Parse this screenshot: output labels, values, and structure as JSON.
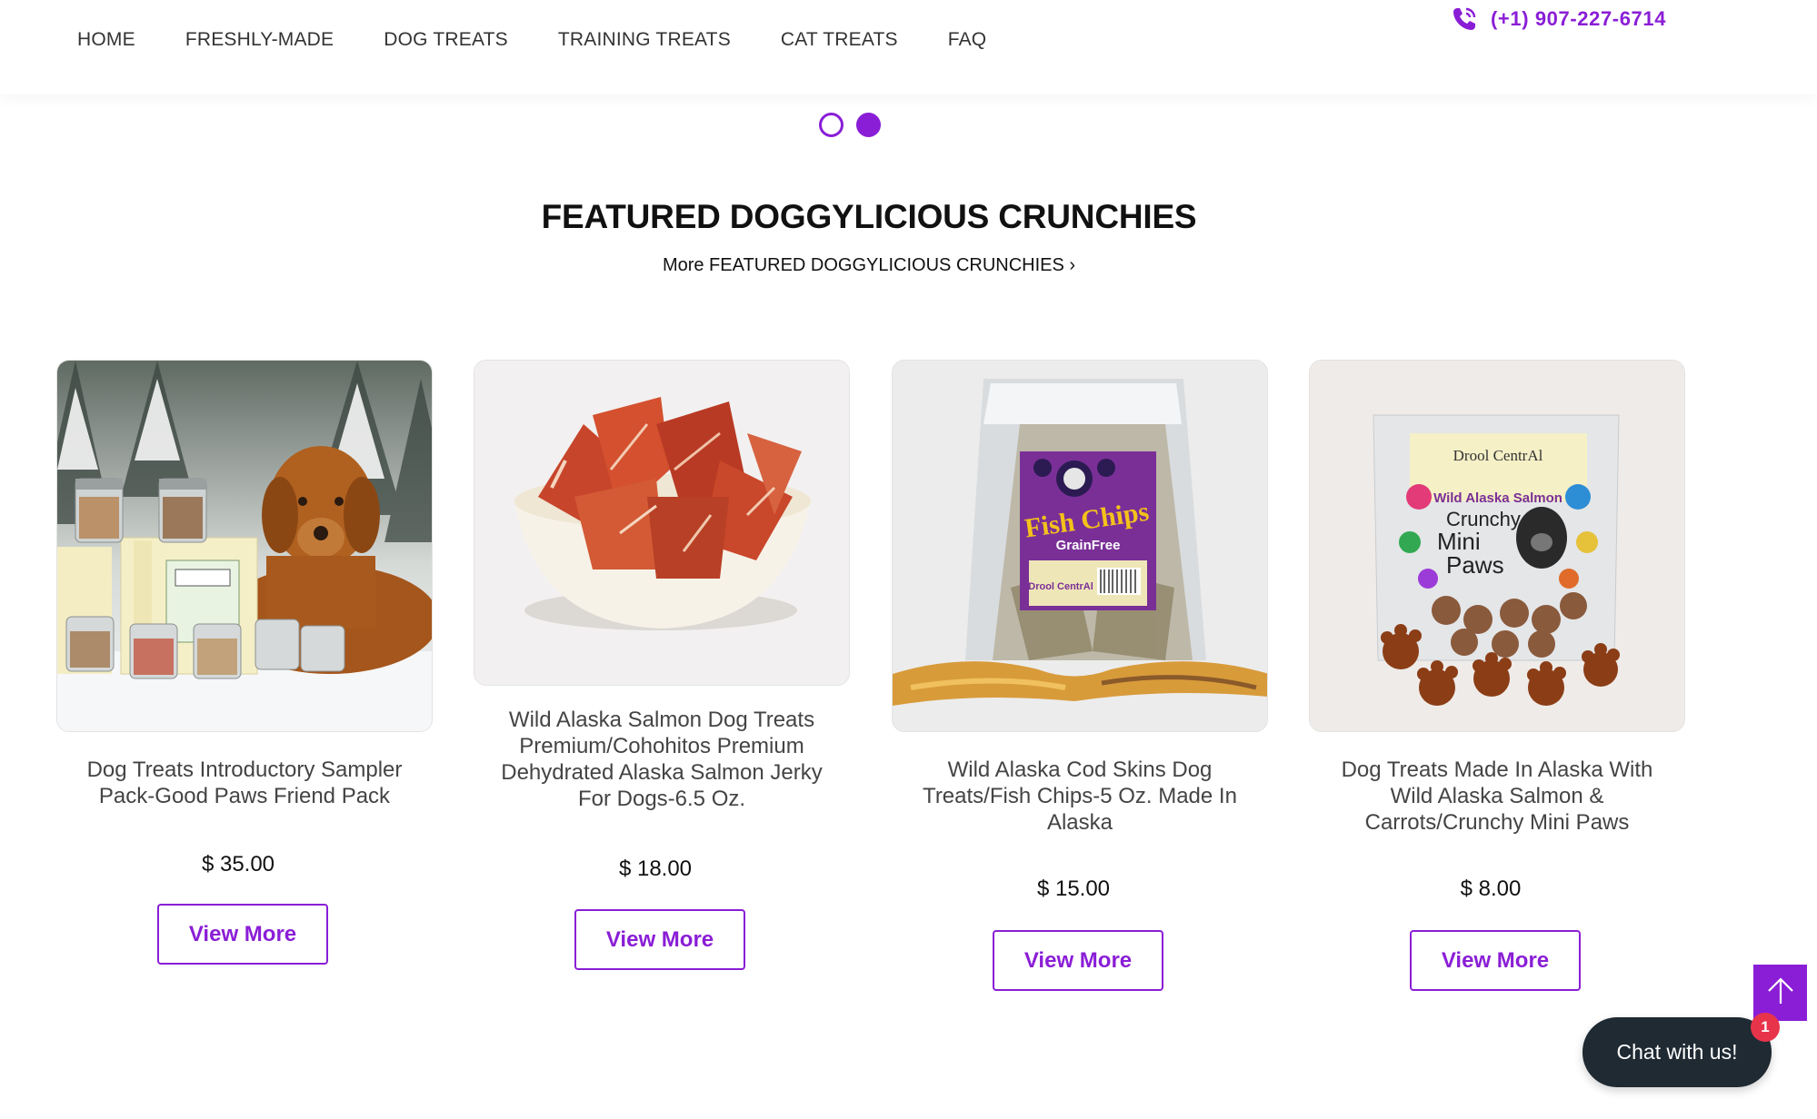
{
  "nav": {
    "items": [
      {
        "label": "HOME"
      },
      {
        "label": "FRESHLY-MADE"
      },
      {
        "label": "DOG TREATS"
      },
      {
        "label": "TRAINING TREATS"
      },
      {
        "label": "CAT TREATS"
      },
      {
        "label": "FAQ"
      }
    ],
    "phone": "(+1) 907-227-6714"
  },
  "slider": {
    "dot_count": 2,
    "active_index": 1
  },
  "section": {
    "title": "FEATURED DOGGYLICIOUS CRUNCHIES",
    "more_link": "More FEATURED DOGGYLICIOUS CRUNCHIES ›"
  },
  "products": [
    {
      "title": "Dog Treats Introductory Sampler Pack-Good Paws Friend Pack",
      "price": "$ 35.00",
      "button": "View More",
      "image_icon": "golden-retriever-with-treat-jars-image"
    },
    {
      "title": "Wild Alaska Salmon Dog Treats Premium/Cohohitos Premium Dehydrated Alaska Salmon Jerky For Dogs-6.5 Oz.",
      "price": "$ 18.00",
      "button": "View More",
      "image_icon": "salmon-jerky-bowl-image"
    },
    {
      "title": "Wild Alaska Cod Skins Dog Treats/Fish Chips-5 Oz. Made In Alaska",
      "price": "$ 15.00",
      "button": "View More",
      "image_icon": "fish-chips-bag-image",
      "package_text": {
        "line1": "Fish Chips",
        "line2": "GrainFree",
        "brand": "Drool CentrAl"
      }
    },
    {
      "title": "Dog Treats Made In Alaska With Wild Alaska Salmon & Carrots/Crunchy Mini Paws",
      "price": "$ 8.00",
      "button": "View More",
      "image_icon": "mini-paws-bag-image",
      "package_text": {
        "brand": "Drool CentrAl",
        "line1": "Wild Alaska Salmon",
        "line2": "Crunchy",
        "line3": "Mini",
        "line4": "Paws"
      }
    }
  ],
  "chat": {
    "label": "Chat with us!",
    "badge": "1"
  },
  "colors": {
    "accent": "#8a1ed6",
    "chat_bg": "#1f2a33",
    "badge": "#e8344a"
  }
}
